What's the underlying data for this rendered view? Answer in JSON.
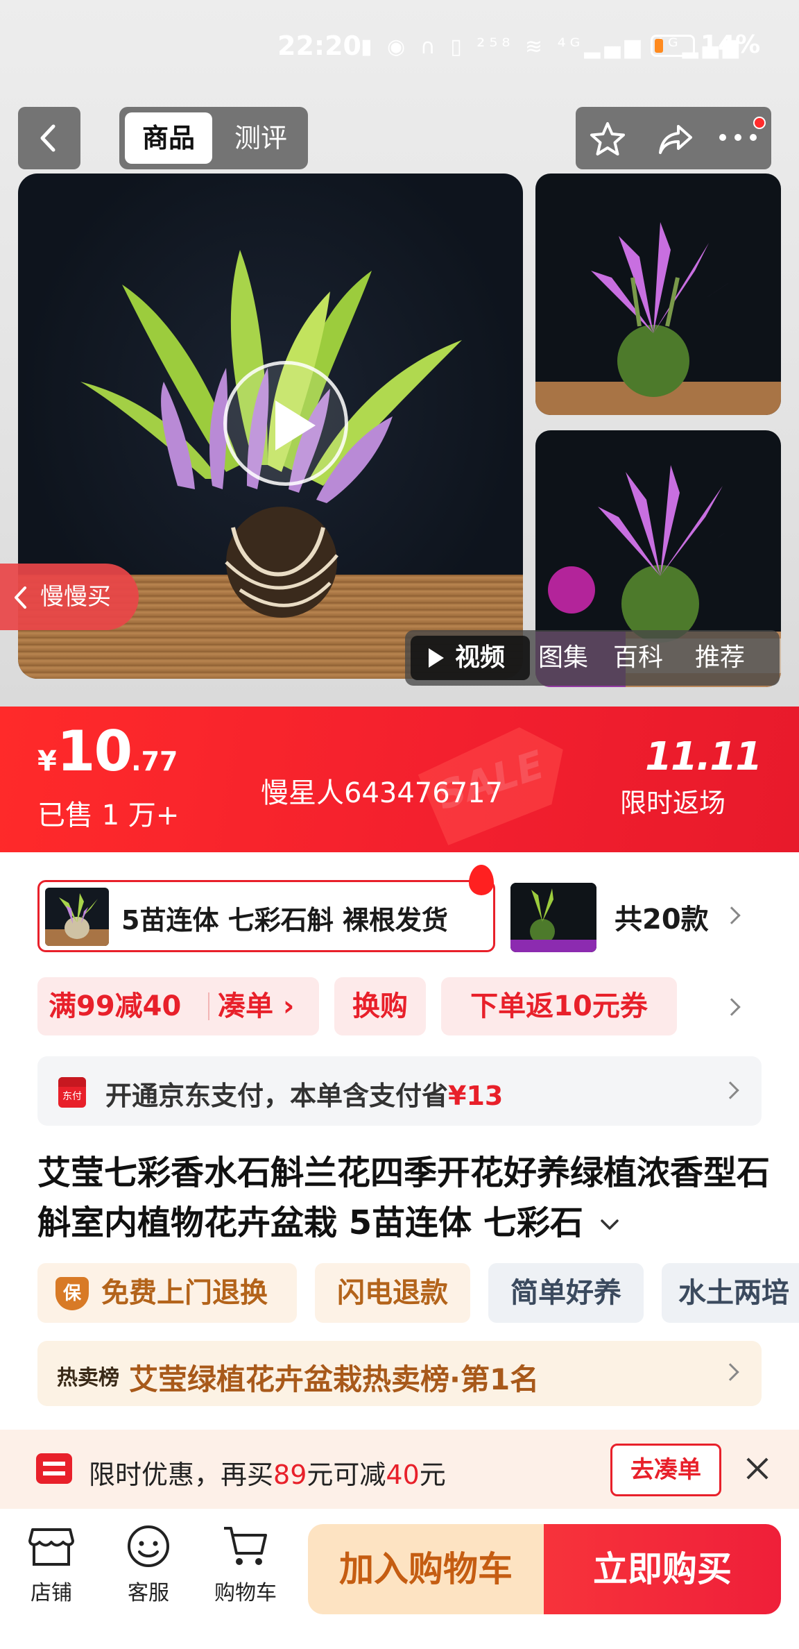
{
  "status_bar": {
    "time": "22:20",
    "icons": "▮ ◉ ∩ ▯ ²⁵⁸ ≋ ⁴ᴳ▂▄▆ ⁴ᴳ▂▄▆",
    "battery_pct": "14%",
    "battery_level": 0.14
  },
  "header": {
    "back_icon": "chevron-left-icon",
    "tab_product": "商品",
    "tab_reviews": "测评",
    "actions": [
      "star-icon",
      "share-icon",
      "more-icon"
    ]
  },
  "gallery": {
    "slow_buy_label": "慢慢买",
    "media_tabs": [
      "视频",
      "图集",
      "百科",
      "推荐"
    ],
    "active_media_tab": "视频"
  },
  "price": {
    "currency": "¥",
    "integer": "10",
    "decimal": ".77",
    "sold": "已售 1 万+",
    "seller": "慢星人643476717",
    "sale_tag": "SALE",
    "event_logo": "11.11",
    "event_label": "限时返场"
  },
  "variants": {
    "selected": "5苗连体 七彩石斛 裸根发货",
    "count_label": "共20款"
  },
  "promos": {
    "full_reduction": "满99减40",
    "combine": "凑单 ›",
    "trade_in": "换购",
    "coupon": "下单返10元券"
  },
  "payment": {
    "icon_text": "东付",
    "text": "开通京东支付，本单含支付省",
    "amount": "¥13"
  },
  "product": {
    "title": "艾莹七彩香水石斛兰花四季开花好养绿植浓香型石斛室内植物花卉盆栽 5苗连体 七彩石"
  },
  "tags": {
    "free_return": "免费上门退换",
    "shield_char": "保",
    "flash_refund": "闪电退款",
    "easy_care": "简单好养",
    "hydro_soil": "水土两培"
  },
  "ranking": {
    "badge": "热卖榜",
    "text": "艾莹绿植花卉盆栽热卖榜·第1名"
  },
  "notice": {
    "prefix": "限时优惠，再买",
    "amount_buy": "89",
    "middle": "元可减",
    "amount_off": "40",
    "suffix": "元",
    "button": "去凑单"
  },
  "bottom_bar": {
    "store": "店铺",
    "service": "客服",
    "cart": "购物车",
    "add_to_cart": "加入购物车",
    "buy_now": "立即购买"
  },
  "colors": {
    "accent_red": "#e8202a",
    "price_band": "#f21f2e",
    "cart_orange": "#fde3c2",
    "tag_orange_text": "#b3631a"
  }
}
